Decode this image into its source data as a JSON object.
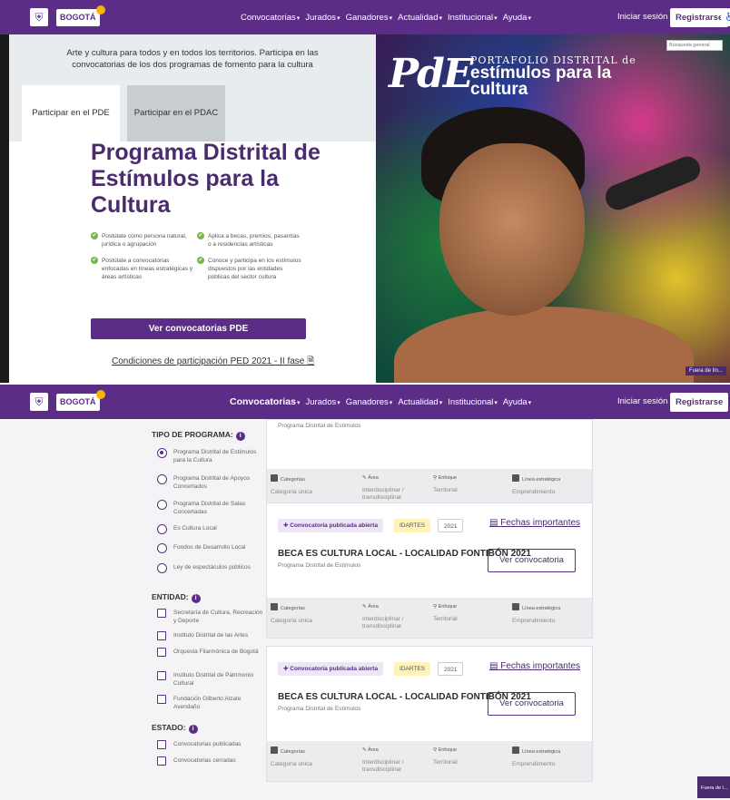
{
  "header": {
    "logo_text": "BOGOTÁ",
    "menu": [
      "Convocatorias",
      "Jurados",
      "Ganadores",
      "Actualidad",
      "Institucional",
      "Ayuda"
    ],
    "login": "Iniciar sesión",
    "register": "Registrarse",
    "search_placeholder": "Búsqueda general"
  },
  "hero": {
    "intro": "Arte y cultura para todos y en todos los territorios. Participa en las convocatorias de los dos programas de fomento para la cultura",
    "tabs": [
      "Participar en el PDE",
      "Participar en el PDAC"
    ],
    "title": "Programa Distrital de Estímulos para la Cultura",
    "features": [
      "Postúlate como persona natural, jurídica o agrupación",
      "Aplica a becas, premios, pasantías o a residencias artísticas",
      "Postúlate a convocatorias enfocadas en líneas estratégicas y áreas artísticas",
      "Conoce y participa en los estímulos dispuestos por las entidades públicas del sector cultura"
    ],
    "cta": "Ver convocatorias PDE",
    "conditions": "Condiciones de participación PED 2021 - II fase",
    "brand_logo": "PdE",
    "brand_line1": "PORTAFOLIO DISTRITAL de",
    "brand_line2": "estímulos para la cultura",
    "fuera": "Fuera de lín..."
  },
  "filters": {
    "program_title": "TIPO DE PROGRAMA:",
    "programs": [
      {
        "label": "Programa Distrital de Estímulos para la Cultura",
        "selected": true
      },
      {
        "label": "Programa Distrital de Apoyos Concertados",
        "selected": false
      },
      {
        "label": "Programa Distrital de Salas Concertadas",
        "selected": false
      },
      {
        "label": "Es Cultura Local",
        "selected": false
      },
      {
        "label": "Fondos de Desarrollo Local",
        "selected": false
      },
      {
        "label": "Ley de espectáculos públicos",
        "selected": false
      }
    ],
    "entity_title": "ENTIDAD:",
    "entities": [
      "Secretaría de Cultura, Recreación y Deporte",
      "Instituto Distrital de las Artes",
      "Orquesta Filarmónica de Bogotá",
      "Instituto Distrital de Patrimonio Cultural",
      "Fundación Gilberto Alzate Avendaño"
    ],
    "status_title": "ESTADO:",
    "statuses": [
      "Convocatorias publicadas",
      "Convocatorias cerradas"
    ]
  },
  "cards": [
    {
      "title": "",
      "subtitle": "Programa Distrital de Estímulos",
      "meta": {
        "categorias_label": "Categorías",
        "categorias_value": "Categoría única",
        "area_label": "Área",
        "area_value": "Interdisciplinar / transdisciplinar",
        "enfoque_label": "Enfoque",
        "enfoque_value": "Territorial",
        "linea_label": "Línea estratégica",
        "linea_value": "Emprendimiento"
      }
    },
    {
      "badge": "Convocatoria publicada abierta",
      "entity": "IDARTES",
      "year": "2021",
      "dates": "Fechas importantes",
      "title": "BECA ES CULTURA LOCAL - LOCALIDAD FONTIBÓN 2021",
      "subtitle": "Programa Distrital de Estímulos",
      "button": "Ver convocatoria",
      "meta": {
        "categorias_label": "Categorías",
        "categorias_value": "Categoría única",
        "area_label": "Área",
        "area_value": "Interdisciplinar / transdisciplinar",
        "enfoque_label": "Enfoque",
        "enfoque_value": "Territorial",
        "linea_label": "Línea estratégica",
        "linea_value": "Emprendimiento"
      }
    },
    {
      "badge": "Convocatoria publicada abierta",
      "entity": "IDARTES",
      "year": "2021",
      "dates": "Fechas importantes",
      "title": "BECA ES CULTURA LOCAL - LOCALIDAD FONTIBÓN 2021",
      "subtitle": "Programa Distrital de Estímulos",
      "button": "Ver convocatoria",
      "meta": {
        "categorias_label": "Categorías",
        "categorias_value": "Categoría única",
        "area_label": "Área",
        "area_value": "Interdisciplinar / transdisciplinar",
        "enfoque_label": "Enfoque",
        "enfoque_value": "Territorial",
        "linea_label": "Línea estratégica",
        "linea_value": "Emprendimiento"
      }
    }
  ],
  "fuera_bottom": "Fuera de l...",
  "colors": {
    "brand": "#5b2d87",
    "title": "#4a2b6d",
    "check": "#7ab648",
    "badge_entity": "#fff3b8"
  }
}
